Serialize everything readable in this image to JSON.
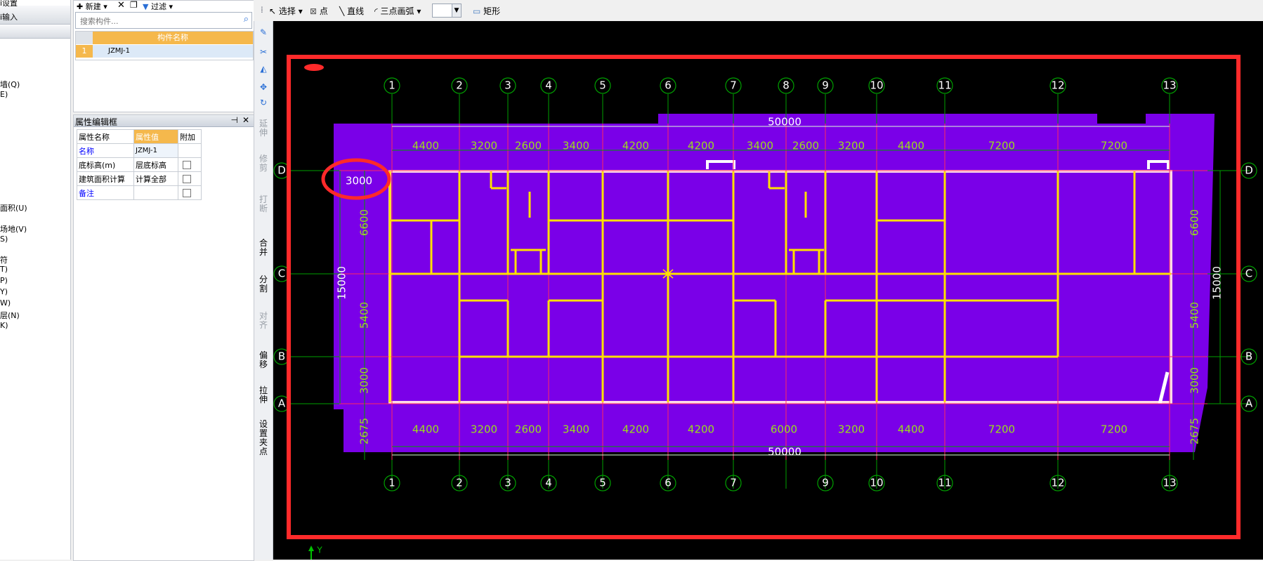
{
  "left_nav": {
    "items": [
      "i设置",
      "i输入",
      "墙(Q)",
      "E)",
      "面积(U)",
      "场地(V)",
      "S)",
      "符",
      "T)",
      "P)",
      "Y)",
      "W)",
      "层(N)",
      "K)"
    ]
  },
  "component_panel": {
    "new_label": "新建",
    "delete_icon": "x-icon",
    "filter_label": "过滤",
    "search_placeholder": "搜索构件...",
    "column_header": "构件名称",
    "rows": [
      {
        "index": "1",
        "name": "JZMJ-1"
      }
    ]
  },
  "property_panel": {
    "title": "属性编辑框",
    "headers": [
      "属性名称",
      "属性值",
      "附加"
    ],
    "rows": [
      {
        "name": "名称",
        "value": "JZMJ-1",
        "blue": true,
        "has_checkbox": false
      },
      {
        "name": "底标高(m)",
        "value": "层底标高",
        "blue": false,
        "has_checkbox": true
      },
      {
        "name": "建筑面积计算",
        "value": "计算全部",
        "blue": false,
        "has_checkbox": true
      },
      {
        "name": "备注",
        "value": "",
        "blue": true,
        "has_checkbox": true
      }
    ]
  },
  "top_toolbar": {
    "select_label": "选择",
    "point_label": "点",
    "line_label": "直线",
    "arc_label": "三点画弧",
    "rect_label": "矩形"
  },
  "vertical_toolbar": {
    "tools": [
      "延伸",
      "修剪",
      "打断",
      "合并",
      "分割",
      "对齐",
      "偏移",
      "拉伸",
      "设置夹点"
    ]
  },
  "drawing": {
    "axes_x_top": [
      "1",
      "2",
      "3",
      "4",
      "5",
      "6",
      "7",
      "8",
      "9",
      "10",
      "11",
      "12",
      "13"
    ],
    "axes_x_bottom": [
      "1",
      "2",
      "3",
      "4",
      "5",
      "6",
      "7",
      "9",
      "10",
      "11",
      "12",
      "13"
    ],
    "axes_y": [
      "D",
      "C",
      "B",
      "A"
    ],
    "top_total": "50000",
    "bottom_total": "50000",
    "top_spans": [
      "4400",
      "3200",
      "2600",
      "3400",
      "4200",
      "4200",
      "3400",
      "2600",
      "3200",
      "4400",
      "7200",
      "7200"
    ],
    "bottom_spans": [
      "4400",
      "3200",
      "2600",
      "3400",
      "4200",
      "4200",
      "6000",
      "3200",
      "4400",
      "7200",
      "7200"
    ],
    "left_spans": [
      "3000",
      "6600",
      "5400",
      "3000",
      "2675"
    ],
    "left_total": "15000",
    "right_spans": [
      "6600",
      "5400",
      "3000",
      "2675"
    ],
    "right_total": "15000",
    "ucs_label": "Y",
    "colors": {
      "slab": "#7a00e8",
      "wall": "#ffe000",
      "grid": "#00a000",
      "dim": "#9ade1c",
      "axis_red": "#ff2020",
      "annotation": "#ff2a2a"
    }
  }
}
